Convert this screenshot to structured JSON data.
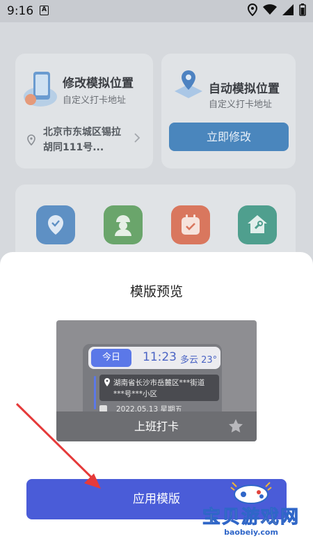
{
  "status_bar": {
    "time": "9:16",
    "a_badge": "A"
  },
  "background": {
    "left_card": {
      "title": "修改模拟位置",
      "subtitle": "自定义打卡地址",
      "address": "北京市东城区锡拉胡同111号..."
    },
    "right_card": {
      "title": "自动模拟位置",
      "subtitle": "自定义打卡地址",
      "button": "立即修改"
    },
    "app_icons": [
      "location-app-icon",
      "worker-app-icon",
      "calendar-check-app-icon",
      "home-repair-app-icon"
    ]
  },
  "sheet": {
    "title": "模版预览",
    "preview": {
      "today": "今日",
      "time": "11:23",
      "weather": "多云 23°",
      "address_line1": "湖南省长沙市岳麓区***街道",
      "address_line2": "***号***小区",
      "date": "2022.05.13 星期五",
      "label": "上班打卡"
    },
    "apply_button": "应用模版"
  },
  "watermark": {
    "text": "宝贝游戏网",
    "url": "baobeiy.com"
  }
}
